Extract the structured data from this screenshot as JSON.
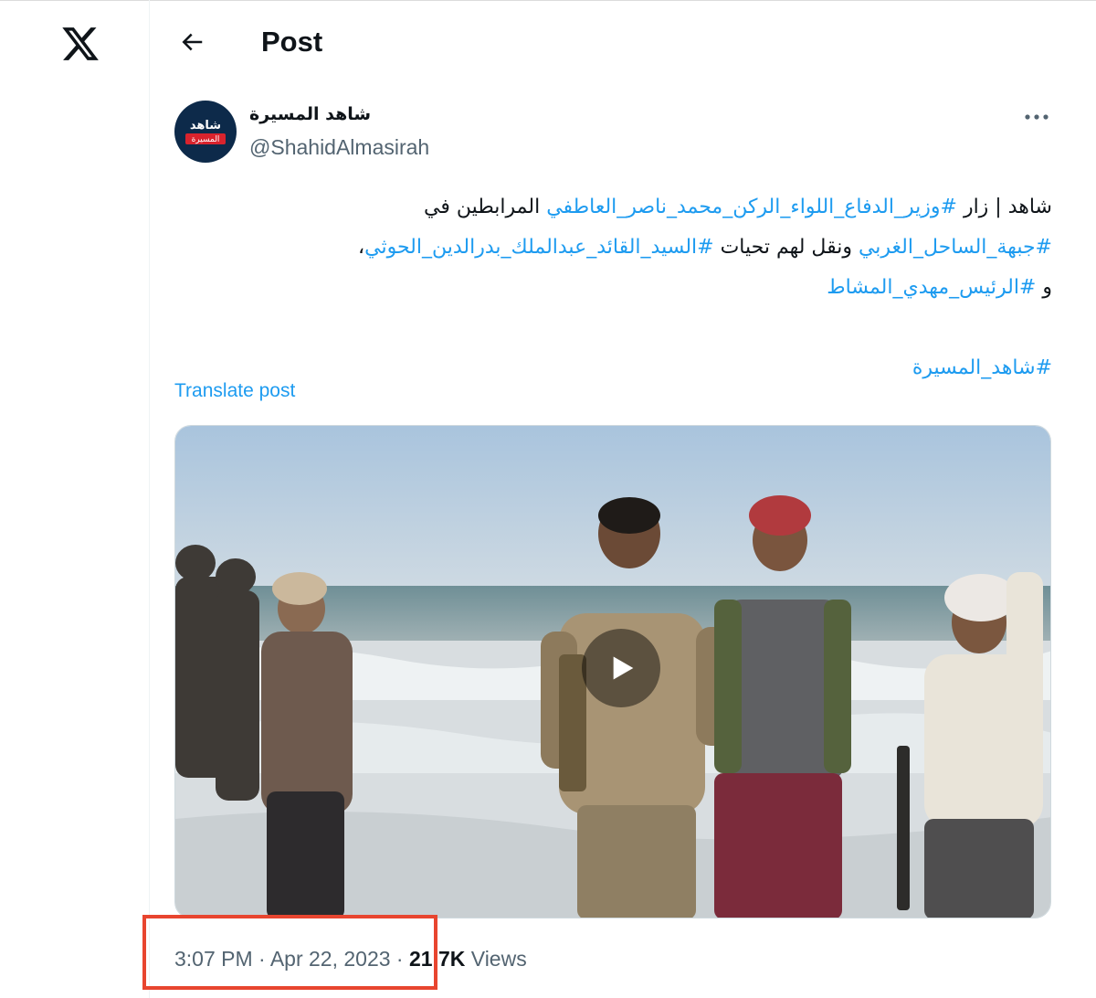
{
  "header": {
    "title": "Post"
  },
  "author": {
    "display_name": "شاهد المسيرة",
    "handle": "@ShahidAlmasirah"
  },
  "tweet": {
    "line1": {
      "p1": "شاهد | زار ",
      "ht1": "#وزير_الدفاع_اللواء_الركن_محمد_ناصر_العاطفي",
      "p2": " المرابطين في"
    },
    "line2": {
      "ht1": "#جبهة_الساحل_الغربي",
      "p1": " ونقل لهم تحيات ",
      "ht2": "#السيد_القائد_عبدالملك_بدرالدين_الحوثي",
      "p2": "،"
    },
    "line3": {
      "p1": "و ",
      "ht1": "#الرئيس_مهدي_المشاط"
    },
    "line4": {
      "ht1": "#شاهد_المسيرة"
    }
  },
  "translate_label": "Translate post",
  "meta": {
    "time": "3:07 PM",
    "separator": " · ",
    "date": "Apr 22, 2023",
    "views_count": "21.7K",
    "views_label": " Views"
  },
  "icons": {
    "logo": "x-logo-icon",
    "back": "arrow-left-icon",
    "more": "more-horizontal-icon",
    "play": "play-icon"
  },
  "colors": {
    "link": "#1d9bf0",
    "text": "#0f1419",
    "secondary": "#536471",
    "highlight": "#e8452f"
  }
}
